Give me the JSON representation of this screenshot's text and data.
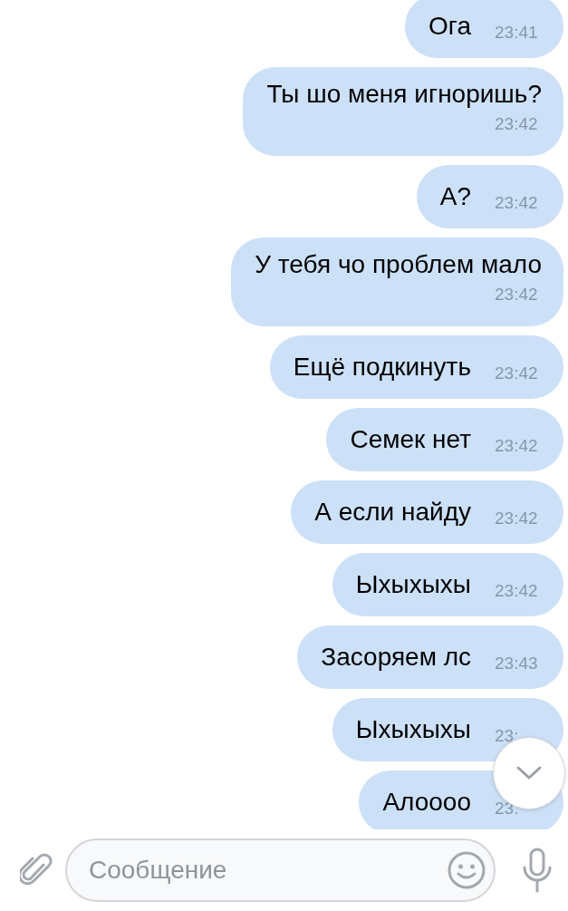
{
  "messages": [
    {
      "kind": "inline",
      "text": "Ога",
      "time": "23:41"
    },
    {
      "kind": "stacked",
      "text": "Ты шо меня игноришь?",
      "time": "23:42"
    },
    {
      "kind": "inline",
      "text": "А?",
      "time": "23:42"
    },
    {
      "kind": "stacked",
      "text": "У тебя чо проблем мало",
      "time": "23:42"
    },
    {
      "kind": "inline",
      "text": "Ещё подкинуть",
      "time": "23:42"
    },
    {
      "kind": "inline",
      "text": "Семек нет",
      "time": "23:42"
    },
    {
      "kind": "inline",
      "text": "А если найду",
      "time": "23:42"
    },
    {
      "kind": "inline",
      "text": "Ыхыхыхы",
      "time": "23:42"
    },
    {
      "kind": "inline",
      "text": "Засоряем лс",
      "time": "23:43"
    },
    {
      "kind": "inline",
      "text": "Ыхыхыхы",
      "time": "23:"
    },
    {
      "kind": "inline",
      "text": "Алоооо",
      "time": "23:"
    }
  ],
  "composer": {
    "placeholder": "Сообщение"
  }
}
